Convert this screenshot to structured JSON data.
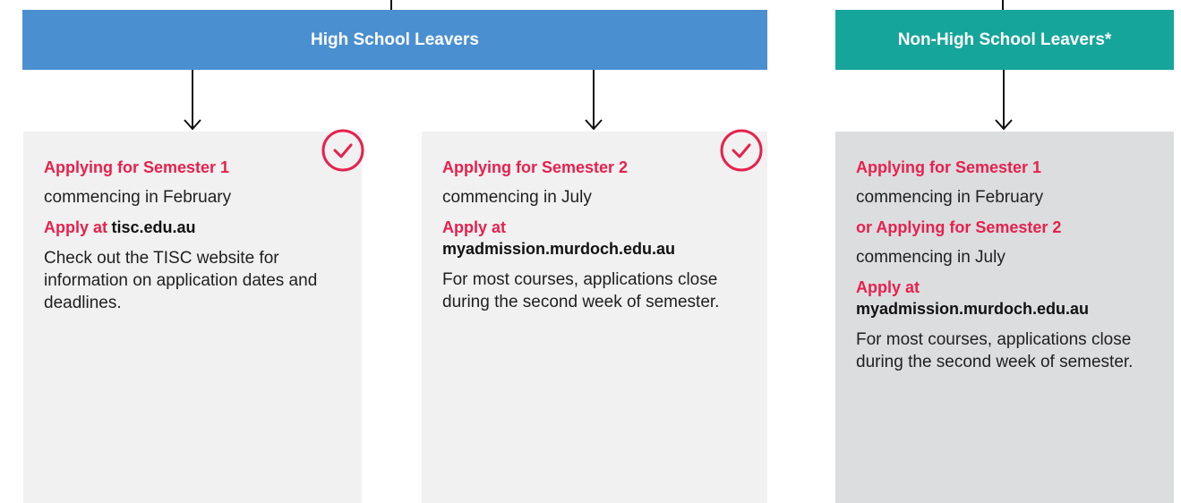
{
  "colors": {
    "blue_header": "#4a8fd0",
    "teal_header": "#16a59b",
    "accent_red": "#e6214e",
    "card_light": "#f1f1f1",
    "card_gray": "#dcdddf"
  },
  "headers": {
    "high_school": "High School Leavers",
    "non_high_school": "Non-High School Leavers*"
  },
  "cards": [
    {
      "title": "Applying for Semester 1",
      "subtitle": "commencing in February",
      "apply_label": "Apply at",
      "apply_site": "tisc.edu.au",
      "note": "Check out the TISC website for information on application dates and deadlines.",
      "icon": "check-circle-icon"
    },
    {
      "title": "Applying for Semester 2",
      "subtitle": "commencing in July",
      "apply_label": "Apply at",
      "apply_site": "myadmission.murdoch.edu.au",
      "note": "For most courses, applications close during the second week of semester.",
      "icon": "check-circle-icon"
    },
    {
      "title": "Applying for Semester 1",
      "subtitle": "commencing in February",
      "alt_title": "or Applying for Semester 2",
      "alt_subtitle": "commencing in July",
      "apply_label": "Apply at",
      "apply_site": "myadmission.murdoch.edu.au",
      "note": "For most courses, applications close during the second week of semester."
    }
  ]
}
